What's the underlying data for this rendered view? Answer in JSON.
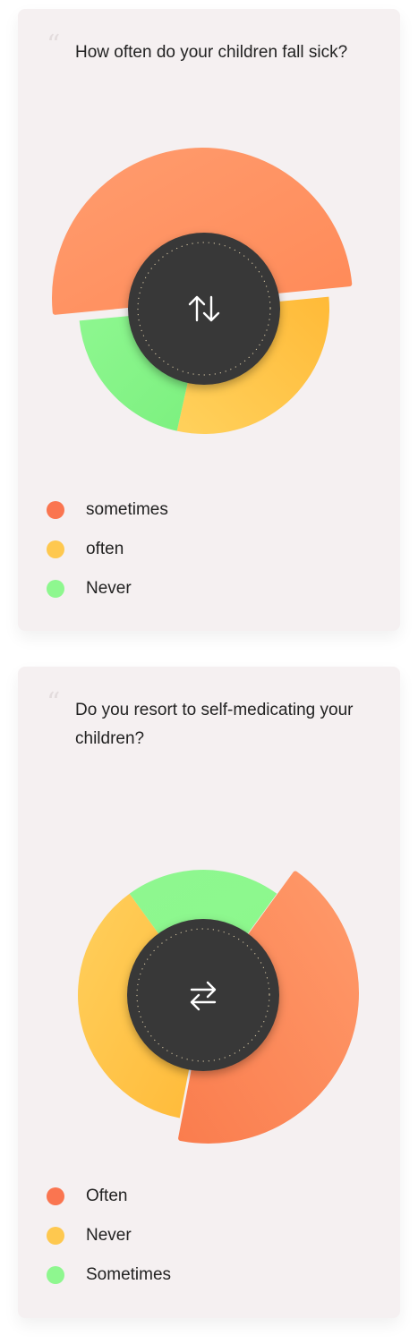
{
  "cards": [
    {
      "question": "How often do your children fall sick?",
      "icon": "swap-vertical-icon",
      "legend": [
        {
          "label": "sometimes",
          "color": "#fa7550"
        },
        {
          "label": "often",
          "color": "#fec84f"
        },
        {
          "label": "Never",
          "color": "#8ef78f"
        }
      ]
    },
    {
      "question": "Do you resort to self-medicating your children?",
      "icon": "swap-horizontal-icon",
      "legend": [
        {
          "label": "Often",
          "color": "#fa7550"
        },
        {
          "label": "Never",
          "color": "#fec84f"
        },
        {
          "label": "Sometimes",
          "color": "#8ef78f"
        }
      ]
    }
  ],
  "chart_data": [
    {
      "type": "pie",
      "categories": [
        "sometimes",
        "often",
        "Never"
      ],
      "values": [
        50,
        30,
        20
      ],
      "colors": [
        "#ff9263",
        "#fec048",
        "#8ef78f"
      ],
      "highlighted": "sometimes"
    },
    {
      "type": "pie",
      "categories": [
        "Often",
        "Never",
        "Sometimes"
      ],
      "values": [
        43,
        37,
        20
      ],
      "colors": [
        "#ff8c5c",
        "#fec048",
        "#8ef78f"
      ],
      "highlighted": "Often"
    }
  ]
}
